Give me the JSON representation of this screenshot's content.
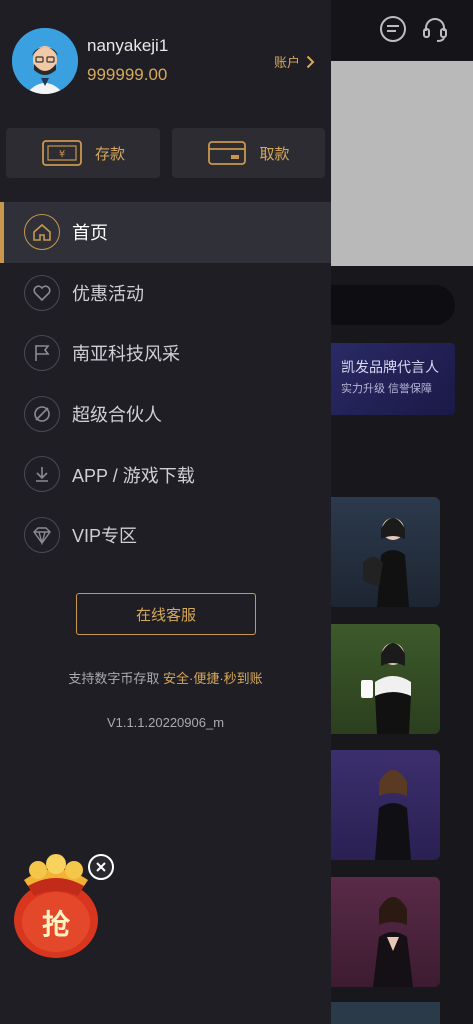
{
  "user": {
    "username": "nanyakeji1",
    "balance": "999999.00",
    "account_label": "账户"
  },
  "actions": {
    "deposit_label": "存款",
    "withdraw_label": "取款"
  },
  "menu": {
    "items": [
      {
        "label": "首页",
        "icon": "home-icon",
        "active": true
      },
      {
        "label": "优惠活动",
        "icon": "heart-icon",
        "active": false
      },
      {
        "label": "南亚科技风采",
        "icon": "flag-icon",
        "active": false
      },
      {
        "label": "超级合伙人",
        "icon": "partner-icon",
        "active": false
      },
      {
        "label": "APP / 游戏下载",
        "icon": "download-icon",
        "active": false
      },
      {
        "label": "VIP专区",
        "icon": "diamond-icon",
        "active": false
      }
    ]
  },
  "service_button": "在线客服",
  "tagline": {
    "prefix": "支持数字币存取",
    "highlight": "安全·便捷·秒到账"
  },
  "version": "V1.1.1.20220906_m",
  "background": {
    "promo_title": "凯发品牌代言人",
    "promo_subtitle": "实力升级 信誉保障"
  },
  "redbag_label": "抢",
  "colors": {
    "accent": "#c9974d",
    "drawer_bg": "#1f1e24",
    "active_bg": "#2f3038"
  }
}
